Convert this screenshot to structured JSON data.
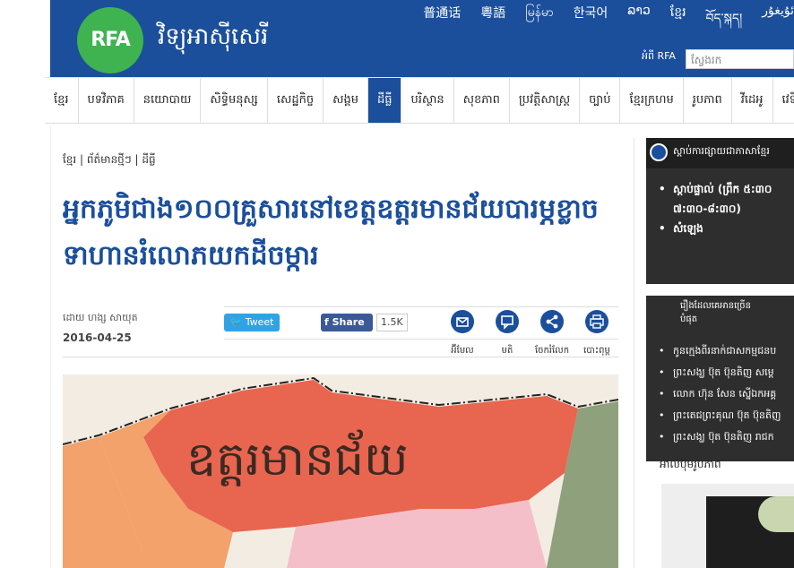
{
  "header": {
    "logo_text": "RFA",
    "site_name": "វិទ្យុអាស៊ីសេរី",
    "languages": [
      "普通话",
      "粵語",
      "မြန်မာ",
      "한국어",
      "ລາວ",
      "ខ្មែរ",
      "བོད་སྐད།",
      "ئۇيغۇر"
    ],
    "about_label": "អំពី RFA",
    "search_placeholder": "ស្វែងរក"
  },
  "nav": {
    "items": [
      "ខ្មែរ",
      "បទវិភាគ",
      "នយោបាយ",
      "សិទ្ធិមនុស្ស",
      "សេដ្ឋកិច្ច",
      "សង្គម",
      "ដីធ្លី",
      "បរិស្ថាន",
      "សុខភាព",
      "ប្រវត្តិសាស្ត្រ",
      "ច្បាប់",
      "ខ្មែរក្រហម",
      "រូបភាព",
      "វីដេអូ",
      "វេទិកាអ្នក"
    ],
    "active_index": 6
  },
  "article": {
    "breadcrumb": "ខ្មែរ | ព័ត៌មានថ្មីៗ | ដីធ្លី",
    "headline": "អ្នកភូមិជាង១០០គ្រួសារនៅខេត្តឧត្ដរមានជ័យបារម្ភខ្លាចទាហានរំលោភយកដីចម្ការ",
    "byline": "ដោយ ហង្ស សាយុត",
    "date": "2016-04-25",
    "tweet_label": "Tweet",
    "share_label": "Share",
    "share_count": "1.5K",
    "tools": [
      {
        "icon": "email-icon",
        "label": "អ៊ីមែល"
      },
      {
        "icon": "comment-icon",
        "label": "មតិ"
      },
      {
        "icon": "share-icon",
        "label": "ចែករំលែក"
      },
      {
        "icon": "print-icon",
        "label": "បោះពុម្ព"
      }
    ],
    "map_label": "ឧត្ដរមានជ័យ"
  },
  "sidebar": {
    "listen_title": "ស្ដាប់ការផ្សាយជាភាសាខ្មែរ",
    "listen_items": [
      "ស្ដាប់ផ្ទាល់ (ព្រឹក ៥:៣០",
      "៧:៣០-៨:៣០)",
      "សំឡេង"
    ],
    "popular_title": "រឿងដែលគេអានច្រើនបំផុត",
    "popular_items": [
      "កូនក្មេងពីរនាក់ជាសកម្មជនប",
      "ព្រះសង្ឃ ប៊ុត ប៊ុនតិញ សម្ដេ",
      "លោក ហ៊ុន សែន ស្នើឯកអគ្គ",
      "ព្រះតេជព្រះគុណ ប៊ុត ប៊ុនតិញ",
      "ព្រះសង្ឃ ប៊ុត ប៊ុនតិញ រាជក"
    ],
    "photo_title": "អាល់ប៊ុមរូបភាព"
  },
  "colors": {
    "brand_blue": "#1b4f9c",
    "logo_green": "#3fb34f",
    "map_red": "#e8654f",
    "map_orange": "#f2a26a",
    "map_green": "#8fa07c",
    "map_pink": "#f4bfc8"
  }
}
